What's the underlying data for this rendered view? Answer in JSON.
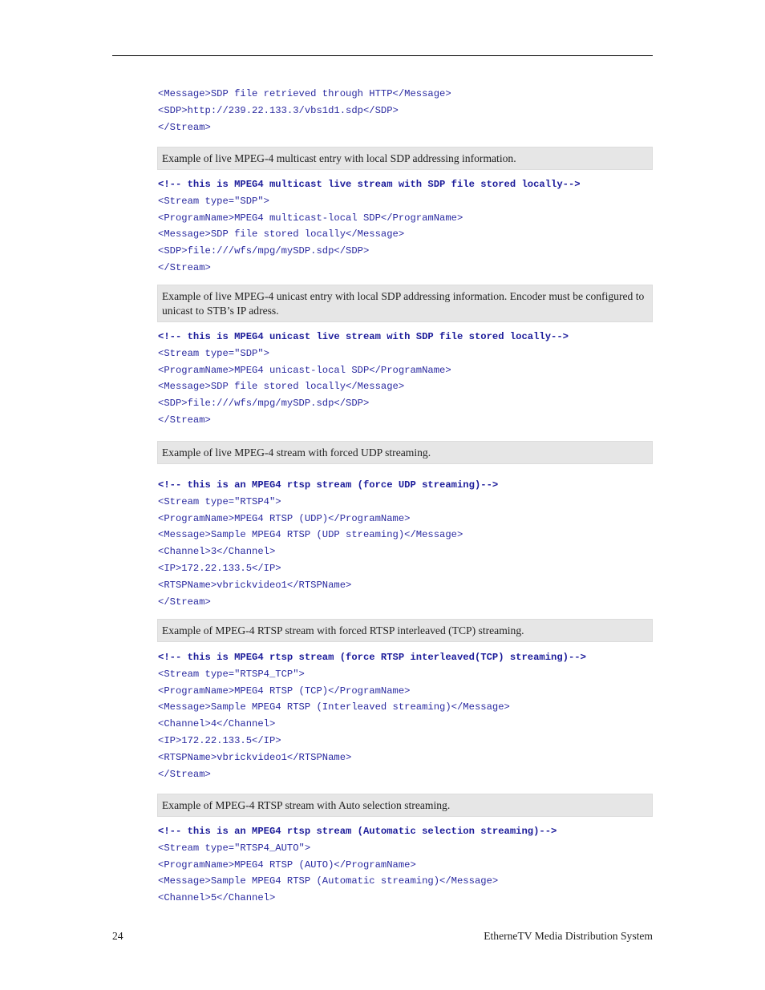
{
  "blocks": [
    {
      "type": "code",
      "lines": [
        {
          "text": "<Message>SDP file retrieved through HTTP</Message>",
          "comment": false
        },
        {
          "text": "<SDP>http://239.22.133.3/vbs1d1.sdp</SDP>",
          "comment": false
        },
        {
          "text": "</Stream>",
          "comment": false
        }
      ]
    },
    {
      "type": "note",
      "text": "Example of live MPEG-4 multicast entry with local SDP addressing information."
    },
    {
      "type": "code",
      "lines": [
        {
          "text": "<!-- this is MPEG4 multicast live stream with SDP file stored locally-->",
          "comment": true
        },
        {
          "text": "<Stream type=\"SDP\">",
          "comment": false
        },
        {
          "text": "<ProgramName>MPEG4 multicast-local SDP</ProgramName>",
          "comment": false
        },
        {
          "text": "<Message>SDP file stored locally</Message>",
          "comment": false
        },
        {
          "text": "<SDP>file:///wfs/mpg/mySDP.sdp</SDP>",
          "comment": false
        },
        {
          "text": "</Stream>",
          "comment": false
        }
      ]
    },
    {
      "type": "note",
      "text": "Example of live MPEG-4 unicast entry with local SDP addressing information. Encoder must be configured to unicast to STB’s IP adress."
    },
    {
      "type": "code",
      "lines": [
        {
          "text": "<!-- this is MPEG4 unicast live stream with SDP file stored locally-->",
          "comment": true
        },
        {
          "text": "<Stream type=\"SDP\">",
          "comment": false
        },
        {
          "text": "<ProgramName>MPEG4 unicast-local SDP</ProgramName>",
          "comment": false
        },
        {
          "text": "<Message>SDP file stored locally</Message>",
          "comment": false
        },
        {
          "text": "<SDP>file:///wfs/mpg/mySDP.sdp</SDP>",
          "comment": false
        },
        {
          "text": "</Stream>",
          "comment": false
        }
      ]
    },
    {
      "type": "note",
      "text": "Example of live MPEG-4 stream with forced UDP streaming."
    },
    {
      "type": "code",
      "lines": [
        {
          "text": "<!-- this is an MPEG4 rtsp stream (force UDP streaming)-->",
          "comment": true
        },
        {
          "text": "<Stream type=\"RTSP4\">",
          "comment": false
        },
        {
          "text": "<ProgramName>MPEG4 RTSP (UDP)</ProgramName>",
          "comment": false
        },
        {
          "text": "<Message>Sample MPEG4 RTSP (UDP streaming)</Message>",
          "comment": false
        },
        {
          "text": "<Channel>3</Channel>",
          "comment": false
        },
        {
          "text": "<IP>172.22.133.5</IP>",
          "comment": false
        },
        {
          "text": "<RTSPName>vbrickvideo1</RTSPName>",
          "comment": false
        },
        {
          "text": "</Stream>",
          "comment": false
        }
      ]
    },
    {
      "type": "note",
      "text": "Example of MPEG-4 RTSP stream with forced RTSP interleaved (TCP) streaming."
    },
    {
      "type": "code",
      "lines": [
        {
          "text": "<!-- this is MPEG4 rtsp stream (force RTSP interleaved(TCP) streaming)-->",
          "comment": true
        },
        {
          "text": "<Stream type=\"RTSP4_TCP\">",
          "comment": false
        },
        {
          "text": "<ProgramName>MPEG4 RTSP (TCP)</ProgramName>",
          "comment": false
        },
        {
          "text": "<Message>Sample MPEG4 RTSP (Interleaved streaming)</Message>",
          "comment": false
        },
        {
          "text": "<Channel>4</Channel>",
          "comment": false
        },
        {
          "text": "<IP>172.22.133.5</IP>",
          "comment": false
        },
        {
          "text": "<RTSPName>vbrickvideo1</RTSPName>",
          "comment": false
        },
        {
          "text": "</Stream>",
          "comment": false
        }
      ]
    },
    {
      "type": "note",
      "text": "Example of MPEG-4 RTSP stream with Auto selection streaming."
    },
    {
      "type": "code",
      "lines": [
        {
          "text": "<!-- this is an MPEG4 rtsp stream (Automatic selection streaming)-->",
          "comment": true
        },
        {
          "text": "<Stream type=\"RTSP4_AUTO\">",
          "comment": false
        },
        {
          "text": "<ProgramName>MPEG4 RTSP (AUTO)</ProgramName>",
          "comment": false
        },
        {
          "text": "<Message>Sample MPEG4 RTSP (Automatic streaming)</Message>",
          "comment": false
        },
        {
          "text": "<Channel>5</Channel>",
          "comment": false
        }
      ]
    }
  ],
  "footer": {
    "page_number": "24",
    "title": "EtherneTV Media Distribution System"
  }
}
